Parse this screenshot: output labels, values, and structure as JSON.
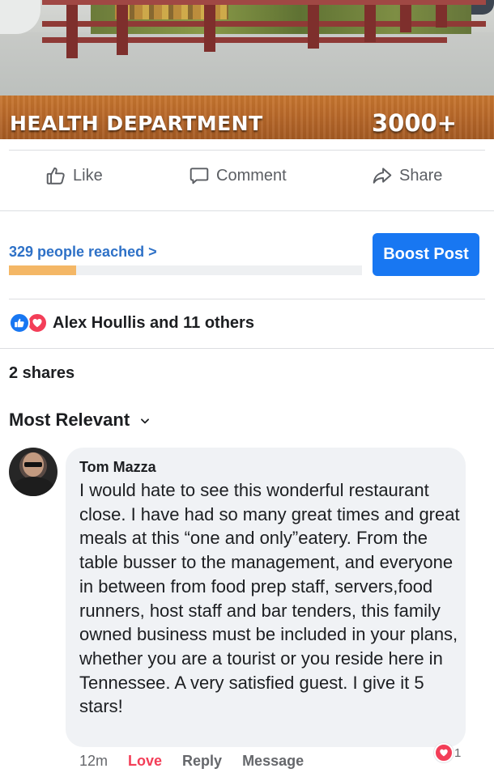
{
  "post_image": {
    "banner_title": "HEALTH DEPARTMENT",
    "banner_number": "3000+"
  },
  "actions": {
    "like": "Like",
    "comment": "Comment",
    "share": "Share"
  },
  "reach": {
    "label": "329 people reached >",
    "progress_fraction": 0.19,
    "boost_label": "Boost Post"
  },
  "reactions": {
    "types": [
      "like",
      "love"
    ],
    "summary": "Alex Houllis and 11 others"
  },
  "shares": "2 shares",
  "sort": {
    "label": "Most Relevant"
  },
  "comment": {
    "author": "Tom Mazza",
    "text": "I would hate to see this wonderful restaurant close. I have had so many great times and great meals at this “one and only”eatery. From the table busser to the management, and everyone in between from food prep staff, servers,food runners, host staff and bar tenders, this family owned business must be included in your plans, whether you are a tourist or you reside here in Tennessee. A very satisfied guest. I give it 5 stars!",
    "time": "12m",
    "love_label": "Love",
    "reply_label": "Reply",
    "message_label": "Message",
    "reaction_count": "1"
  },
  "colors": {
    "facebook_blue": "#1877f2",
    "love_red": "#f33e58",
    "reach_fill": "#f4b766",
    "reach_link": "#2e71c7"
  }
}
